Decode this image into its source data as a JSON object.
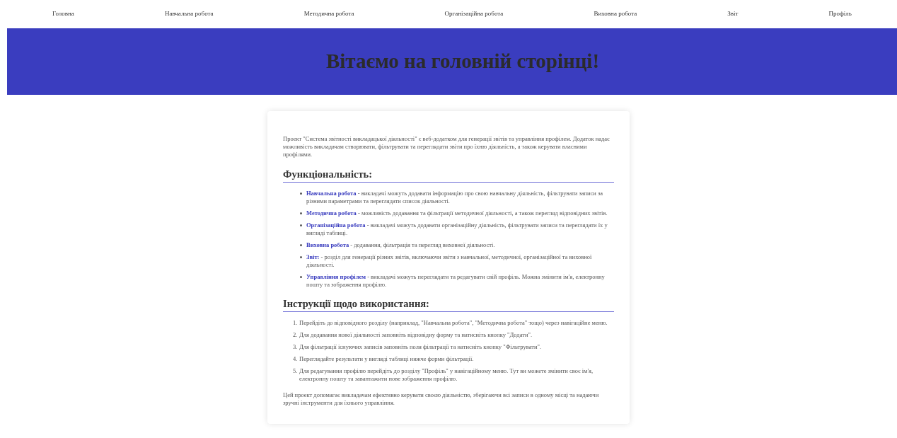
{
  "nav": [
    {
      "label": "Головна"
    },
    {
      "label": "Навчальна робота"
    },
    {
      "label": "Методична робота"
    },
    {
      "label": "Організаційна робота"
    },
    {
      "label": "Виховна робота"
    },
    {
      "label": "Звіт"
    },
    {
      "label": "Профіль"
    }
  ],
  "banner": {
    "title": "Вітаємо на головній сторінці!"
  },
  "intro": "Проект \"Система звітності викладацької діяльності\" є веб-додатком для генерації звітів та управління профілем. Додаток надає можливість викладачам створювати, фільтрувати та переглядати звіти про їхню діяльність, а також керувати власними профілями.",
  "features": {
    "heading": "Функціональність:",
    "items": [
      {
        "link": "Навчальна робота",
        "text": " - викладачі можуть додавати інформацію про свою навчальну діяльність, фільтрувати записи за різними параметрами та переглядати список діяльності."
      },
      {
        "link": "Методична робота",
        "text": " - можливість додавання та фільтрації методичної діяльності, а також перегляд відповідних звітів."
      },
      {
        "link": "Організаційна робота",
        "text": " - викладачі можуть додавати організаційну діяльність, фільтрувати записи та переглядати їх у вигляді таблиці."
      },
      {
        "link": "Виховна робота",
        "text": " - додавання, фільтрація та перегляд виховної діяльності."
      },
      {
        "link": "Звіт:",
        "text": " - розділ для генерації різних звітів, включаючи звіти з навчальної, методичної, організаційної та виховної діяльності."
      },
      {
        "link": "Управління профілем",
        "text": " - викладачі можуть переглядати та редагувати свій профіль. Можна змінити ім'я, електронну пошту та зображення профілю."
      }
    ]
  },
  "instructions": {
    "heading": "Інструкції щодо використання:",
    "steps": [
      {
        "number": "1.",
        "text": "Перейдіть до відповідного розділу (наприклад, \"Навчальна робота\", \"Методична робота\" тощо) через навігаційне меню."
      },
      {
        "number": "2.",
        "text": "Для додавання нової діяльності заповніть відповідну форму та натисніть кнопку \"Додати\"."
      },
      {
        "number": "3.",
        "text": "Для фільтрації існуючих записів заповніть поля фільтрації та натисніть кнопку \"Фільтрувати\"."
      },
      {
        "number": "4.",
        "text": "Переглядайте результати у вигляді таблиці нижче форми фільтрації."
      },
      {
        "number": "5.",
        "text": "Для редагування профілю перейдіть до розділу \"Профіль\" у навігаційному меню. Тут ви можете змінити своє ім'я, електронну пошту та завантажити нове зображення профілю."
      }
    ]
  },
  "outro": "Цей проект допомагає викладачам ефективно керувати своєю діяльністю, зберігаючи всі записи в одному місці та надаючи зручні інструменти для їхнього управління."
}
